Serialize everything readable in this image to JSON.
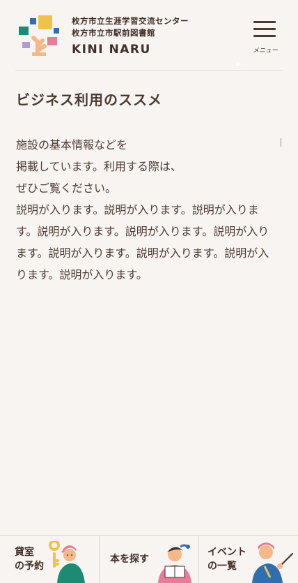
{
  "header": {
    "org_line1": "枚方市立生涯学習交流センター",
    "org_line2": "枚方市立市駅前図書館",
    "brand": "KINI NARU",
    "menu_label": "メニュー",
    "logo_icon": "colorful-blocks-tree-logo",
    "menu_icon": "hamburger-menu-icon"
  },
  "page": {
    "title": "ビジネス利用のススメ",
    "intro_lines": [
      "施設の基本情報などを",
      "掲載しています。利用する際は、",
      "ぜひご覧ください。"
    ],
    "description": "説明が入ります。説明が入ります。説明が入ります。説明が入ります。説明が入ります。説明が入ります。説明が入ります。説明が入ります。説明が入ります。説明が入ります。"
  },
  "footer": {
    "buttons": [
      {
        "line1": "貸室",
        "line2": "の予約",
        "icon": "person-with-key-icon"
      },
      {
        "line1": "本を探す",
        "line2": "",
        "icon": "person-reading-book-icon"
      },
      {
        "line1": "イベント",
        "line2": "の一覧",
        "icon": "person-with-pointer-icon"
      }
    ]
  },
  "colors": {
    "background": "#f8f4f1",
    "text": "#4a3b32",
    "logo_teal": "#1f8a74",
    "logo_yellow": "#f0c24a",
    "logo_blue": "#2f6fb0",
    "logo_pink": "#e87b97",
    "logo_lilac": "#b29ccc",
    "logo_peach": "#f4b98a"
  }
}
